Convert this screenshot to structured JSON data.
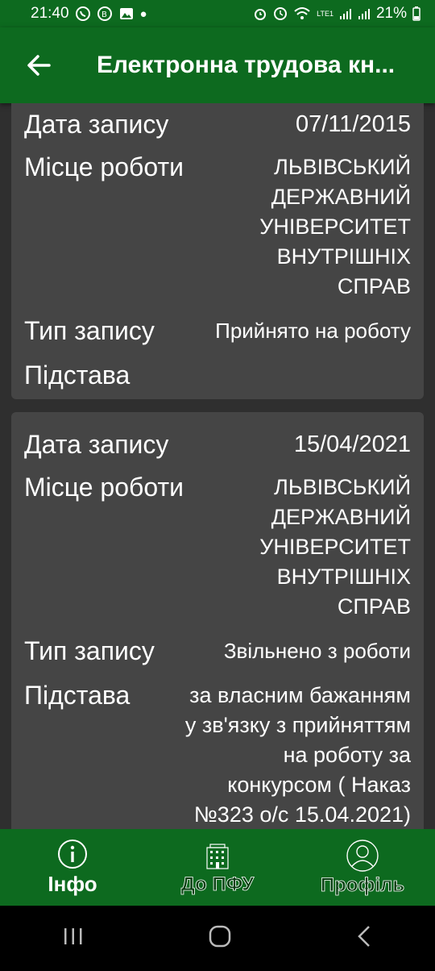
{
  "status": {
    "time": "21:40",
    "battery": "21%",
    "network": "LTE1"
  },
  "header": {
    "title": "Електронна трудова кн..."
  },
  "records": [
    {
      "date_label": "Дата запису",
      "date": "07/11/2015",
      "place_label": "Місце роботи",
      "place": [
        "ЛЬВІВСЬКИЙ",
        "ДЕРЖАВНИЙ",
        "УНІВЕРСИТЕТ",
        "ВНУТРІШНІХ",
        "СПРАВ"
      ],
      "type_label": "Тип запису",
      "type": "Прийнято на роботу",
      "basis_label": "Підстава",
      "basis": []
    },
    {
      "date_label": "Дата запису",
      "date": "15/04/2021",
      "place_label": "Місце роботи",
      "place": [
        "ЛЬВІВСЬКИЙ",
        "ДЕРЖАВНИЙ",
        "УНІВЕРСИТЕТ",
        "ВНУТРІШНІХ",
        "СПРАВ"
      ],
      "type_label": "Тип запису",
      "type": "Звільнено з роботи",
      "basis_label": "Підстава",
      "basis": [
        "за власним бажанням",
        "у зв'язку з прийняттям",
        "на роботу за",
        "конкурсом ( Наказ",
        "№323 о/с 15.04.2021)"
      ]
    }
  ],
  "nav": {
    "info": "Інфо",
    "pfu": "До ПФУ",
    "profile": "Профіль"
  },
  "colors": {
    "primary": "#0d6a1f",
    "card": "#454545",
    "background": "#2f2f2f"
  }
}
